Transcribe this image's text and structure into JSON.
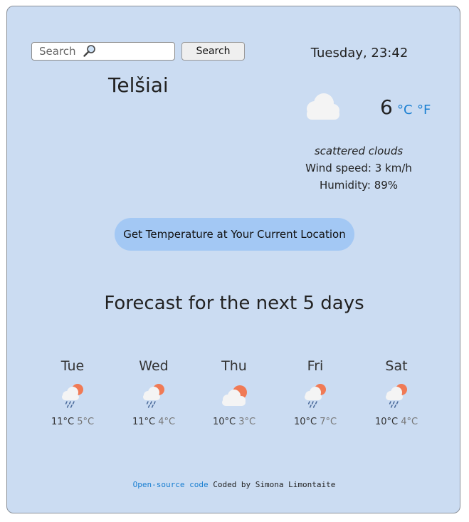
{
  "search": {
    "placeholder": "Search",
    "button_label": "Search"
  },
  "datetime": "Tuesday, 23:42",
  "city": "Telšiai",
  "current": {
    "icon": "cloud-icon",
    "temperature": "6",
    "unit_celsius": "°C",
    "unit_fahrenheit": "°F",
    "description": "scattered clouds",
    "wind": "Wind speed: 3 km/h",
    "humidity": "Humidity: 89%"
  },
  "location_button": "Get Temperature at Your Current Location",
  "forecast": {
    "title": "Forecast for the next 5 days",
    "days": [
      {
        "day": "Tue",
        "max": "11°C",
        "min": "5°C",
        "icon": "sun-rain-cloud-icon"
      },
      {
        "day": "Wed",
        "max": "11°C",
        "min": "4°C",
        "icon": "sun-rain-cloud-icon"
      },
      {
        "day": "Thu",
        "max": "10°C",
        "min": "3°C",
        "icon": "sun-behind-cloud-icon"
      },
      {
        "day": "Fri",
        "max": "10°C",
        "min": "7°C",
        "icon": "sun-rain-cloud-icon"
      },
      {
        "day": "Sat",
        "max": "10°C",
        "min": "4°C",
        "icon": "sun-rain-cloud-icon"
      }
    ]
  },
  "footer": {
    "link_text": "Open-source code",
    "credit": " Coded by Simona Limontaite"
  },
  "colors": {
    "background": "#cbdcf2",
    "accent": "#1a7fd1",
    "button": "#a3c8f4",
    "sun": "#f07a55"
  }
}
